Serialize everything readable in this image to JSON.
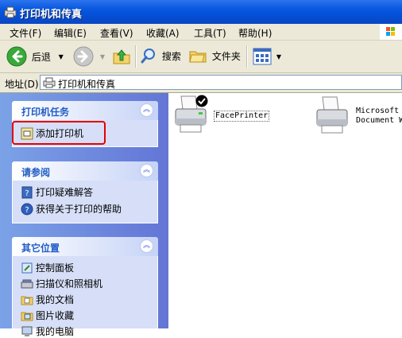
{
  "window": {
    "title": "打印机和传真"
  },
  "menu": {
    "items": [
      {
        "label": "文件(F)"
      },
      {
        "label": "编辑(E)"
      },
      {
        "label": "查看(V)"
      },
      {
        "label": "收藏(A)"
      },
      {
        "label": "工具(T)"
      },
      {
        "label": "帮助(H)"
      }
    ]
  },
  "toolbar": {
    "back_label": "后退",
    "search_label": "搜索",
    "folders_label": "文件夹"
  },
  "address": {
    "label": "地址(D)",
    "value": "打印机和传真"
  },
  "task_panels": [
    {
      "title": "打印机任务",
      "links": [
        {
          "label": "添加打印机",
          "icon": "add-printer-icon"
        }
      ]
    },
    {
      "title": "请参阅",
      "links": [
        {
          "label": "打印疑难解答",
          "icon": "help-book-icon"
        },
        {
          "label": "获得关于打印的帮助",
          "icon": "help-icon"
        }
      ]
    },
    {
      "title": "其它位置",
      "links": [
        {
          "label": "控制面板",
          "icon": "control-panel-icon"
        },
        {
          "label": "扫描仪和照相机",
          "icon": "scanner-icon"
        },
        {
          "label": "我的文档",
          "icon": "documents-folder-icon"
        },
        {
          "label": "图片收藏",
          "icon": "pictures-folder-icon"
        },
        {
          "label": "我的电脑",
          "icon": "my-computer-icon"
        }
      ]
    }
  ],
  "printers": [
    {
      "name": "FacePrinter",
      "default": true
    },
    {
      "name": "Microsoft XPS Document Writer",
      "line1": "Microsoft",
      "line2": "Document W"
    }
  ],
  "colors": {
    "titlebar": "#0a5ae0",
    "pane": "#6d8ee0",
    "panel_title": "#215dc6",
    "highlight": "#e60000"
  }
}
